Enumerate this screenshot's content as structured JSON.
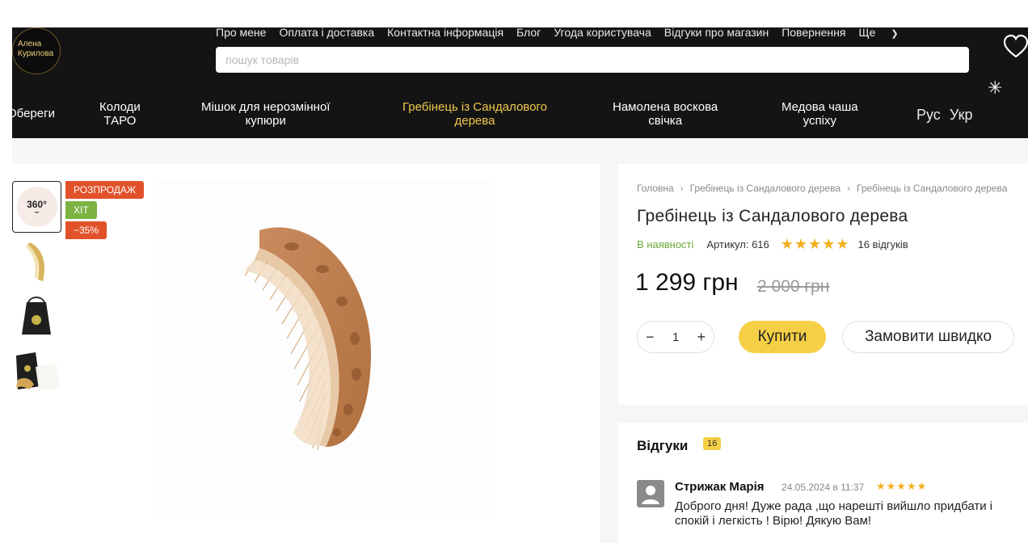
{
  "header": {
    "logo_text": "Алена\nКурилова",
    "top_links": [
      "Про мене",
      "Оплата і доставка",
      "Контактна інформація",
      "Блог",
      "Угода користувача",
      "Відгуки про магазин",
      "Повернення",
      "Ще"
    ],
    "search_placeholder": "пошук товарів",
    "categories": [
      "Обереги",
      "Колоди\nТАРО",
      "Мішок для нерозмінної\nкупюри",
      "Гребінець із Сандалового\nдерева",
      "Намолена воскова\nсвічка",
      "Медова чаша\nуспіху"
    ],
    "lang_ru": "Рус",
    "lang_uk": "Укр"
  },
  "gallery": {
    "thumb_360": "360°",
    "badges": {
      "sale": "РОЗПРОДАЖ",
      "hit": "ХІТ",
      "discount": "−35%"
    }
  },
  "product": {
    "breadcrumbs": [
      "Головна",
      "Гребінець із Сандалового дерева",
      "Гребінець із Сандалового дерева"
    ],
    "title": "Гребінець із Сандалового дерева",
    "stock": "В наявності",
    "sku": "Артикул: 616",
    "rating_stars": "★★★★★",
    "reviews_count": "16 відгуків",
    "price": "1 299 грн",
    "old_price": "2 000 грн",
    "quantity": "1",
    "qty_minus": "−",
    "qty_plus": "+",
    "buy_label": "Купити",
    "quick_order_label": "Замовити швидко"
  },
  "reviews": {
    "title": "Відгуки",
    "count": "16",
    "items": [
      {
        "author": "Стрижак Марія",
        "date": "24.05.2024 в 11:37",
        "stars": "★★★★★",
        "text": "Доброго дня! Дуже рада ,що нарешті вийшло придбати і\nспокій і легкість ! Вірю! Дякую Вам!"
      }
    ]
  },
  "colors": {
    "header_bg": "#141414",
    "accent": "#f5cf45",
    "sale": "#e1522b",
    "hit": "#7cb342"
  }
}
